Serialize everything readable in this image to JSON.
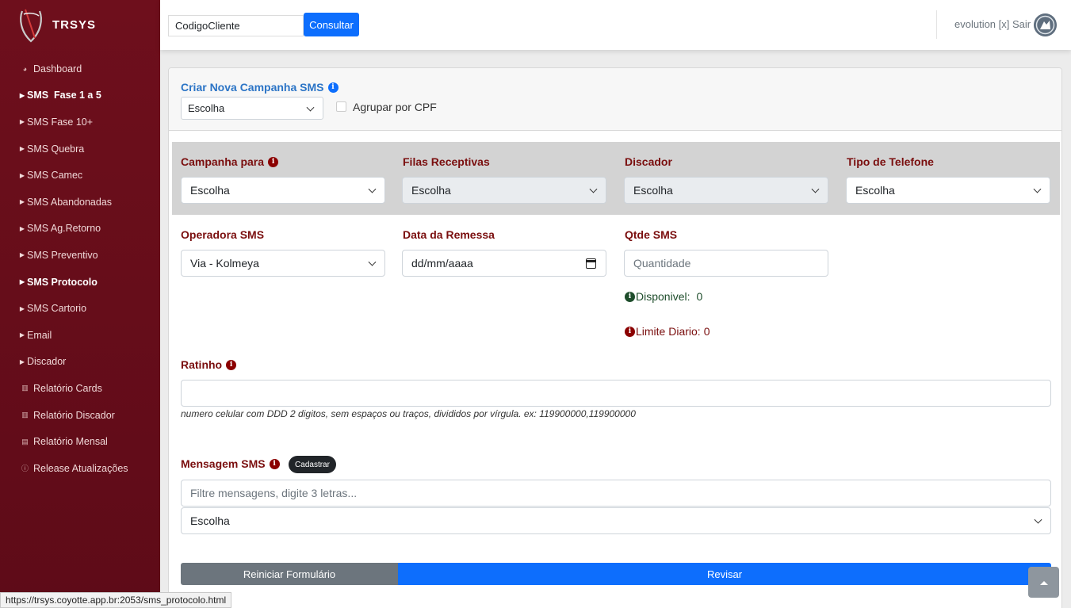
{
  "brand": {
    "name": "TRSYS"
  },
  "sidebar": {
    "items": [
      {
        "label": "Dashboard",
        "icon": "dashboard-icon",
        "bold": false
      },
      {
        "label": "SMS  Fase 1 a 5",
        "icon": "caret-right-icon",
        "bold": true
      },
      {
        "label": "SMS Fase 10+",
        "icon": "caret-right-icon",
        "bold": false
      },
      {
        "label": "SMS Quebra",
        "icon": "caret-right-icon",
        "bold": false
      },
      {
        "label": "SMS Camec",
        "icon": "caret-right-icon",
        "bold": false
      },
      {
        "label": "SMS Abandonadas",
        "icon": "caret-right-icon",
        "bold": false
      },
      {
        "label": "SMS Ag.Retorno",
        "icon": "caret-right-icon",
        "bold": false
      },
      {
        "label": "SMS Preventivo",
        "icon": "caret-right-icon",
        "bold": false
      },
      {
        "label": "SMS Protocolo",
        "icon": "caret-right-icon",
        "bold": true
      },
      {
        "label": "SMS Cartorio",
        "icon": "caret-right-icon",
        "bold": false
      },
      {
        "label": "Email",
        "icon": "caret-right-icon",
        "bold": false
      },
      {
        "label": "Discador",
        "icon": "caret-right-icon",
        "bold": false
      },
      {
        "label": "Relatório Cards",
        "icon": "bar-chart-icon",
        "bold": false
      },
      {
        "label": "Relatório Discador",
        "icon": "bar-chart-icon",
        "bold": false
      },
      {
        "label": "Relatório Mensal",
        "icon": "table-icon",
        "bold": false
      },
      {
        "label": "Release Atualizações",
        "icon": "info-icon",
        "bold": false
      }
    ]
  },
  "topbar": {
    "client_value": "CodigoCliente",
    "consult_label": "Consultar",
    "user_text": "evolution [x] Sair"
  },
  "header": {
    "title": "Criar Nova Campanha SMS",
    "campaign_select": "Escolha",
    "group_cpf_label": "Agrupar por CPF"
  },
  "form": {
    "campanha_para": {
      "label": "Campanha para",
      "value": "Escolha"
    },
    "filas_receptivas": {
      "label": "Filas Receptivas",
      "value": "Escolha"
    },
    "discador": {
      "label": "Discador",
      "value": "Escolha"
    },
    "tipo_telefone": {
      "label": "Tipo de Telefone",
      "value": "Escolha"
    },
    "operadora": {
      "label": "Operadora SMS",
      "value": "Via - Kolmeya"
    },
    "data_remessa": {
      "label": "Data da Remessa",
      "value": "dd/mm/aaaa"
    },
    "qtde": {
      "label": "Qtde SMS",
      "placeholder": "Quantidade"
    },
    "disponivel": {
      "label": "Disponivel:",
      "value": "0"
    },
    "limite": {
      "label": "Limite Diario:",
      "value": "0"
    },
    "ratinho": {
      "label": "Ratinho",
      "value": "",
      "hint": "numero celular com DDD 2 digitos, sem espaços ou traços, divididos por vírgula. ex: 119900000,119900000"
    },
    "mensagem": {
      "label": "Mensagem SMS",
      "badge": "Cadastrar",
      "filter_placeholder": "Filtre mensagens, digite 3 letras...",
      "select_value": "Escolha"
    }
  },
  "actions": {
    "reset_label": "Reiniciar Formulário",
    "review_label": "Revisar"
  },
  "status_bar": {
    "url": "https://trsys.coyotte.app.br:2053/sms_protocolo.html"
  },
  "colors": {
    "sidebar": "#6e0f1c",
    "accent_blue": "#0d6efd",
    "label_red": "#7a0e0e"
  }
}
